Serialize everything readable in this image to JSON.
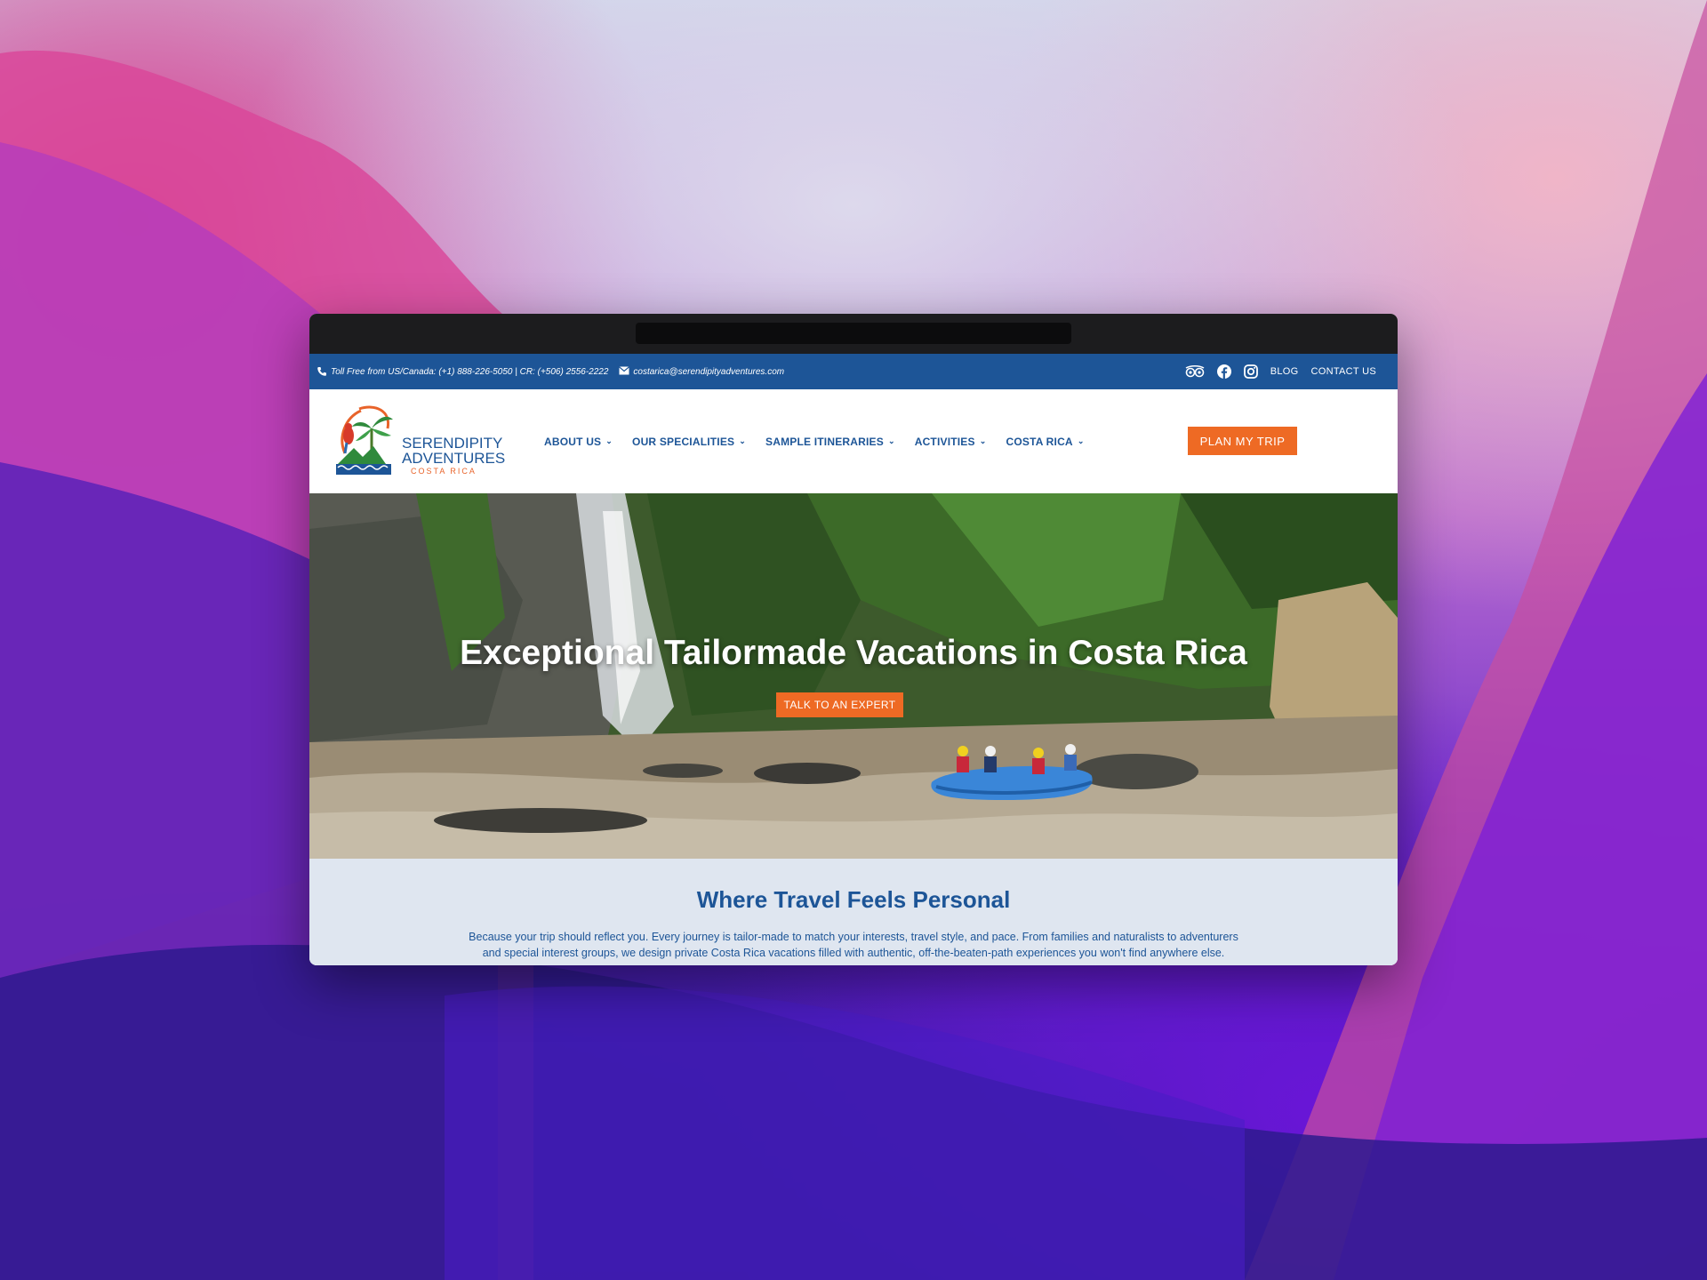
{
  "topbar": {
    "phone_text": "Toll Free from US/Canada: (+1) 888-226-5050 | CR: (+506) 2556-2222",
    "email_text": "costarica@serendipityadventures.com",
    "blog_label": "BLOG",
    "contact_label": "CONTACT US"
  },
  "logo": {
    "line1": "SERENDIPITY",
    "line2": "ADVENTURES",
    "line3": "COSTA RICA"
  },
  "nav": {
    "items": [
      {
        "label": "ABOUT US"
      },
      {
        "label": "OUR SPECIALITIES"
      },
      {
        "label": "SAMPLE ITINERARIES"
      },
      {
        "label": "ACTIVITIES"
      },
      {
        "label": "COSTA RICA"
      }
    ],
    "plan_label": "PLAN MY TRIP"
  },
  "hero": {
    "title": "Exceptional Tailormade Vacations in Costa Rica",
    "cta_label": "TALK TO AN EXPERT"
  },
  "intro": {
    "title": "Where Travel Feels Personal",
    "body": "Because your trip should reflect you. Every journey is tailor-made to match your interests, travel style, and pace. From families and naturalists to adventurers and special interest groups, we design private Costa Rica vacations filled with authentic, off-the-beaten-path experiences you won't find anywhere else."
  },
  "colors": {
    "brand_blue": "#1d5597",
    "accent_orange": "#ee6a24",
    "intro_bg": "#dfe6f0"
  },
  "icons": [
    "phone-icon",
    "mail-icon",
    "tripadvisor-icon",
    "facebook-icon",
    "instagram-icon",
    "chevron-down-icon"
  ]
}
